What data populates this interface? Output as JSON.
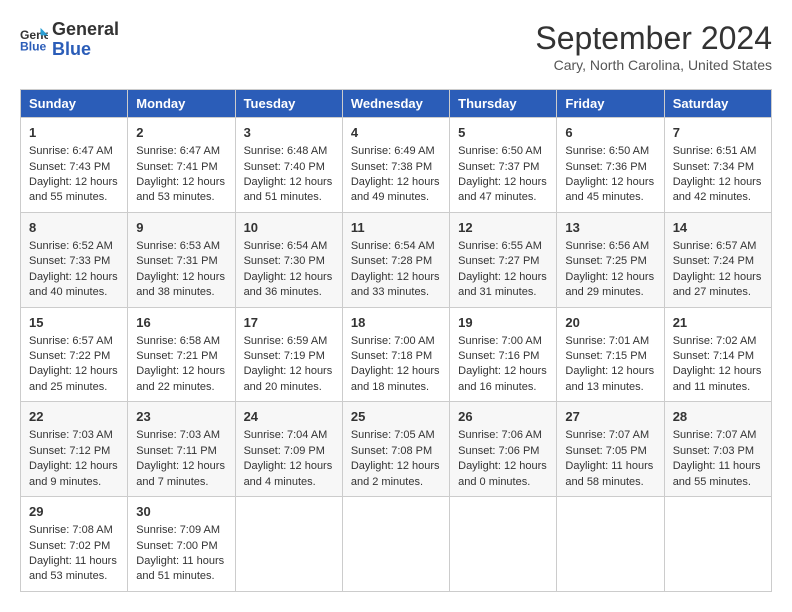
{
  "header": {
    "logo_line1": "General",
    "logo_line2": "Blue",
    "month": "September 2024",
    "location": "Cary, North Carolina, United States"
  },
  "days_of_week": [
    "Sunday",
    "Monday",
    "Tuesday",
    "Wednesday",
    "Thursday",
    "Friday",
    "Saturday"
  ],
  "weeks": [
    [
      {
        "day": "1",
        "sunrise": "Sunrise: 6:47 AM",
        "sunset": "Sunset: 7:43 PM",
        "daylight": "Daylight: 12 hours and 55 minutes."
      },
      {
        "day": "2",
        "sunrise": "Sunrise: 6:47 AM",
        "sunset": "Sunset: 7:41 PM",
        "daylight": "Daylight: 12 hours and 53 minutes."
      },
      {
        "day": "3",
        "sunrise": "Sunrise: 6:48 AM",
        "sunset": "Sunset: 7:40 PM",
        "daylight": "Daylight: 12 hours and 51 minutes."
      },
      {
        "day": "4",
        "sunrise": "Sunrise: 6:49 AM",
        "sunset": "Sunset: 7:38 PM",
        "daylight": "Daylight: 12 hours and 49 minutes."
      },
      {
        "day": "5",
        "sunrise": "Sunrise: 6:50 AM",
        "sunset": "Sunset: 7:37 PM",
        "daylight": "Daylight: 12 hours and 47 minutes."
      },
      {
        "day": "6",
        "sunrise": "Sunrise: 6:50 AM",
        "sunset": "Sunset: 7:36 PM",
        "daylight": "Daylight: 12 hours and 45 minutes."
      },
      {
        "day": "7",
        "sunrise": "Sunrise: 6:51 AM",
        "sunset": "Sunset: 7:34 PM",
        "daylight": "Daylight: 12 hours and 42 minutes."
      }
    ],
    [
      {
        "day": "8",
        "sunrise": "Sunrise: 6:52 AM",
        "sunset": "Sunset: 7:33 PM",
        "daylight": "Daylight: 12 hours and 40 minutes."
      },
      {
        "day": "9",
        "sunrise": "Sunrise: 6:53 AM",
        "sunset": "Sunset: 7:31 PM",
        "daylight": "Daylight: 12 hours and 38 minutes."
      },
      {
        "day": "10",
        "sunrise": "Sunrise: 6:54 AM",
        "sunset": "Sunset: 7:30 PM",
        "daylight": "Daylight: 12 hours and 36 minutes."
      },
      {
        "day": "11",
        "sunrise": "Sunrise: 6:54 AM",
        "sunset": "Sunset: 7:28 PM",
        "daylight": "Daylight: 12 hours and 33 minutes."
      },
      {
        "day": "12",
        "sunrise": "Sunrise: 6:55 AM",
        "sunset": "Sunset: 7:27 PM",
        "daylight": "Daylight: 12 hours and 31 minutes."
      },
      {
        "day": "13",
        "sunrise": "Sunrise: 6:56 AM",
        "sunset": "Sunset: 7:25 PM",
        "daylight": "Daylight: 12 hours and 29 minutes."
      },
      {
        "day": "14",
        "sunrise": "Sunrise: 6:57 AM",
        "sunset": "Sunset: 7:24 PM",
        "daylight": "Daylight: 12 hours and 27 minutes."
      }
    ],
    [
      {
        "day": "15",
        "sunrise": "Sunrise: 6:57 AM",
        "sunset": "Sunset: 7:22 PM",
        "daylight": "Daylight: 12 hours and 25 minutes."
      },
      {
        "day": "16",
        "sunrise": "Sunrise: 6:58 AM",
        "sunset": "Sunset: 7:21 PM",
        "daylight": "Daylight: 12 hours and 22 minutes."
      },
      {
        "day": "17",
        "sunrise": "Sunrise: 6:59 AM",
        "sunset": "Sunset: 7:19 PM",
        "daylight": "Daylight: 12 hours and 20 minutes."
      },
      {
        "day": "18",
        "sunrise": "Sunrise: 7:00 AM",
        "sunset": "Sunset: 7:18 PM",
        "daylight": "Daylight: 12 hours and 18 minutes."
      },
      {
        "day": "19",
        "sunrise": "Sunrise: 7:00 AM",
        "sunset": "Sunset: 7:16 PM",
        "daylight": "Daylight: 12 hours and 16 minutes."
      },
      {
        "day": "20",
        "sunrise": "Sunrise: 7:01 AM",
        "sunset": "Sunset: 7:15 PM",
        "daylight": "Daylight: 12 hours and 13 minutes."
      },
      {
        "day": "21",
        "sunrise": "Sunrise: 7:02 AM",
        "sunset": "Sunset: 7:14 PM",
        "daylight": "Daylight: 12 hours and 11 minutes."
      }
    ],
    [
      {
        "day": "22",
        "sunrise": "Sunrise: 7:03 AM",
        "sunset": "Sunset: 7:12 PM",
        "daylight": "Daylight: 12 hours and 9 minutes."
      },
      {
        "day": "23",
        "sunrise": "Sunrise: 7:03 AM",
        "sunset": "Sunset: 7:11 PM",
        "daylight": "Daylight: 12 hours and 7 minutes."
      },
      {
        "day": "24",
        "sunrise": "Sunrise: 7:04 AM",
        "sunset": "Sunset: 7:09 PM",
        "daylight": "Daylight: 12 hours and 4 minutes."
      },
      {
        "day": "25",
        "sunrise": "Sunrise: 7:05 AM",
        "sunset": "Sunset: 7:08 PM",
        "daylight": "Daylight: 12 hours and 2 minutes."
      },
      {
        "day": "26",
        "sunrise": "Sunrise: 7:06 AM",
        "sunset": "Sunset: 7:06 PM",
        "daylight": "Daylight: 12 hours and 0 minutes."
      },
      {
        "day": "27",
        "sunrise": "Sunrise: 7:07 AM",
        "sunset": "Sunset: 7:05 PM",
        "daylight": "Daylight: 11 hours and 58 minutes."
      },
      {
        "day": "28",
        "sunrise": "Sunrise: 7:07 AM",
        "sunset": "Sunset: 7:03 PM",
        "daylight": "Daylight: 11 hours and 55 minutes."
      }
    ],
    [
      {
        "day": "29",
        "sunrise": "Sunrise: 7:08 AM",
        "sunset": "Sunset: 7:02 PM",
        "daylight": "Daylight: 11 hours and 53 minutes."
      },
      {
        "day": "30",
        "sunrise": "Sunrise: 7:09 AM",
        "sunset": "Sunset: 7:00 PM",
        "daylight": "Daylight: 11 hours and 51 minutes."
      },
      null,
      null,
      null,
      null,
      null
    ]
  ]
}
